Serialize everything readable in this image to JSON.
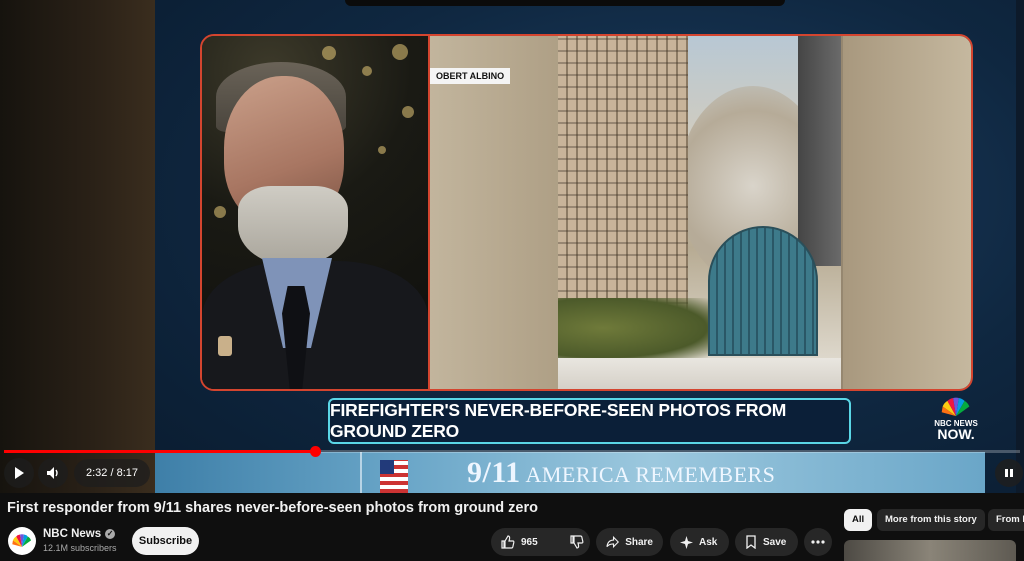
{
  "video": {
    "name_tag": "OBERT ALBINO",
    "headline": "FIREFIGHTER'S NEVER-BEFORE-SEEN PHOTOS FROM GROUND ZERO",
    "logo_line1": "NBC NEWS",
    "logo_line2": "NOW.",
    "banner_big": "9/11",
    "banner_rest": "AMERICA REMEMBERS"
  },
  "controls": {
    "current_time": "2:32",
    "duration": "8:17",
    "time_display": "2:32 / 8:17",
    "progress_fraction": 0.306
  },
  "meta": {
    "title": "First responder from 9/11 shares never-before-seen photos from ground zero",
    "channel": "NBC News",
    "subscribers": "12.1M subscribers",
    "subscribe_label": "Subscribe"
  },
  "actions": {
    "likes": "965",
    "share": "Share",
    "ask": "Ask",
    "save": "Save"
  },
  "chips": [
    "All",
    "More from this story",
    "From N"
  ],
  "colors": {
    "accent_red": "#ff0000",
    "panel_border": "#d4452f",
    "headline_border": "#5ad6e6"
  }
}
